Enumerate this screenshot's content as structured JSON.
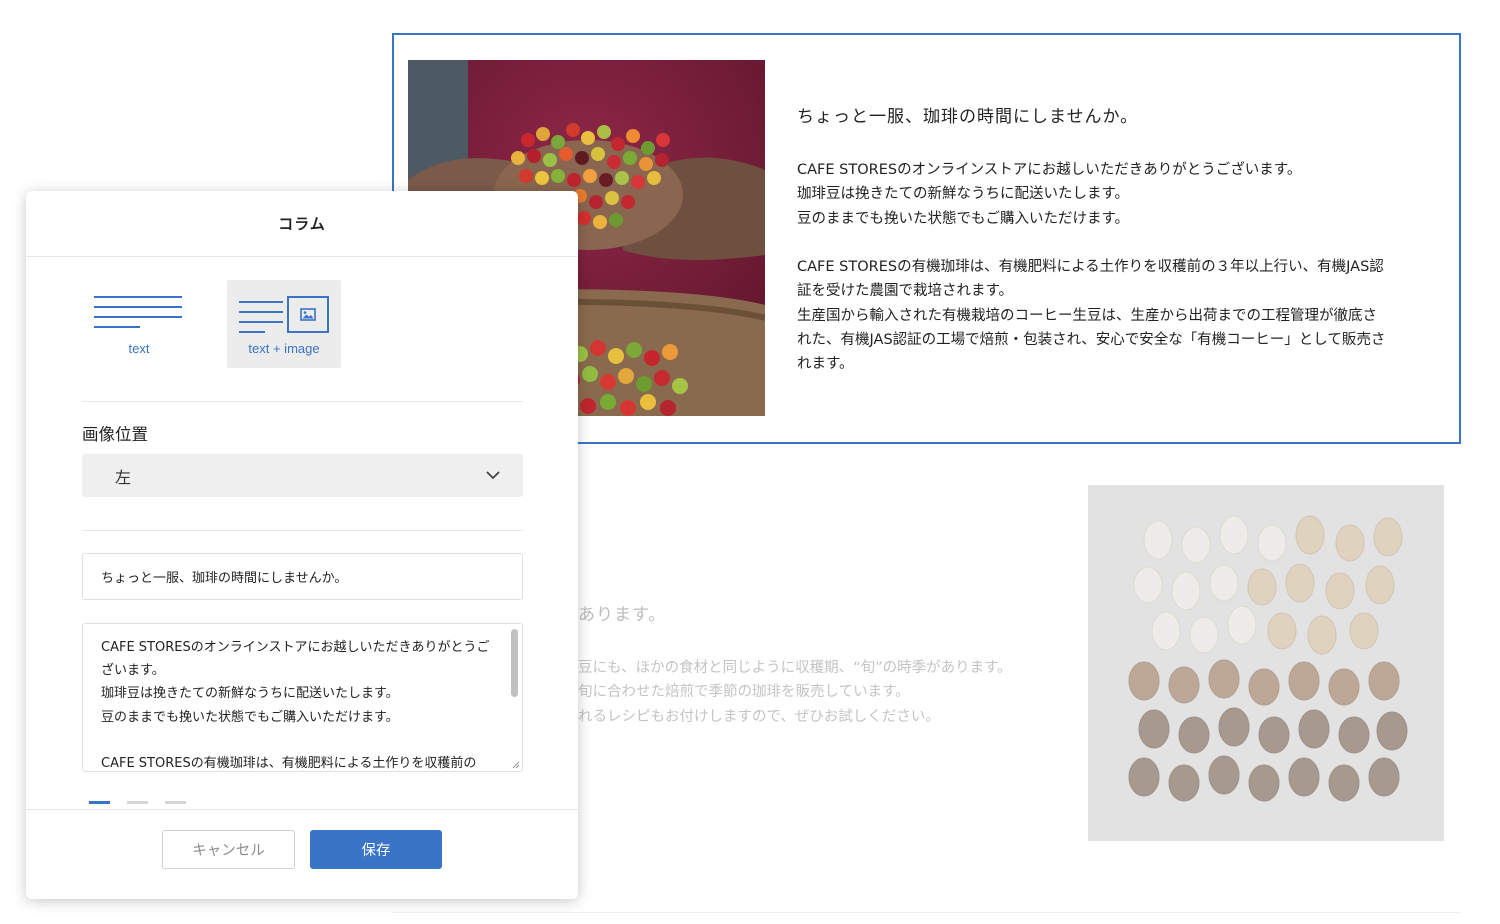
{
  "page": {
    "block1": {
      "heading": "ちょっと一服、珈琲の時間にしませんか。",
      "paragraphs": [
        "CAFE STORESのオンラインストアにお越しいただきありがとうございます。\n珈琲豆は挽きたての新鮮なうちに配送いたします。\n豆のままでも挽いた状態でもご購入いただけます。",
        "CAFE STORESの有機珈琲は、有機肥料による土作りを収穫前の３年以上行い、有機JAS認\n証を受けた農園で栽培されます。\n生産国から輸入された有機栽培のコーヒー生豆は、生産から出荷までの工程管理が徹底さ\nれた、有機JAS認証の工場で焙煎・包装され、安心で安全な「有機コーヒー」として販売さ\nれます。"
      ]
    },
    "block2": {
      "heading_partial": "あります。",
      "body_partial": "豆にも、ほかの食材と同じように収穫期、“旬”の時季があります。\n旬に合わせた焙煎で季節の珈琲を販売しています。\nれるレシピもお付けしますので、ぜひお試しください。"
    }
  },
  "modal": {
    "title": "コラム",
    "layout_options": [
      {
        "label": "text",
        "selected": false
      },
      {
        "label": "text + image",
        "selected": true
      }
    ],
    "image_position_label": "画像位置",
    "image_position_value": "左",
    "title_input_value": "ちょっと一服、珈琲の時間にしませんか。",
    "body_textarea_value": "CAFE STORESのオンラインストアにお越しいただきありがとうご\nざいます。\n珈琲豆は挽きたての新鮮なうちに配送いたします。\n豆のままでも挽いた状態でもご購入いただけます。\n\nCAFE STORESの有機珈琲は、有機肥料による土作りを収穫前の",
    "pager_active_index": 0,
    "cancel_label": "キャンセル",
    "save_label": "保存"
  },
  "icons": [
    "text-layout-icon",
    "text-image-layout-icon",
    "image-icon",
    "chevron-down-icon"
  ],
  "colors": {
    "accent": "#3a74c6",
    "selected_bg": "#ececec"
  }
}
